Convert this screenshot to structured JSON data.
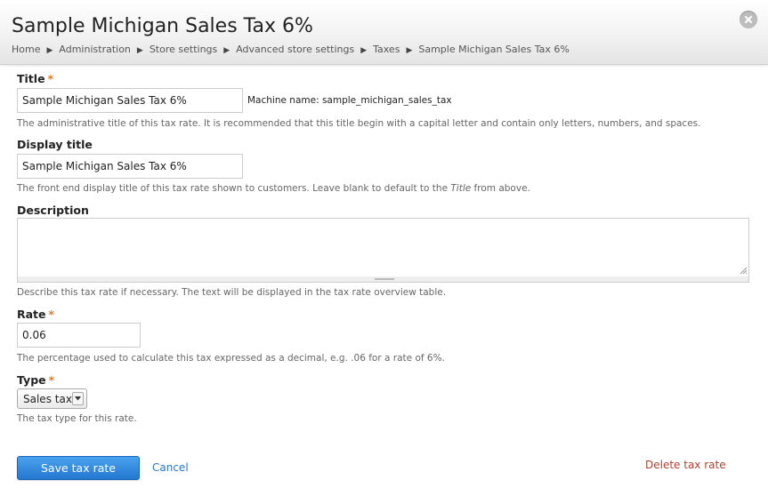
{
  "header": {
    "title": "Sample Michigan Sales Tax 6%",
    "breadcrumb": [
      "Home",
      "Administration",
      "Store settings",
      "Advanced store settings",
      "Taxes",
      "Sample Michigan Sales Tax 6%"
    ],
    "breadcrumb_separator": "▶"
  },
  "form": {
    "required_marker": "*",
    "title": {
      "label": "Title",
      "value": "Sample Michigan Sales Tax 6%",
      "machine_name": "Machine name: sample_michigan_sales_tax",
      "description": "The administrative title of this tax rate. It is recommended that this title begin with a capital letter and contain only letters, numbers, and spaces."
    },
    "display_title": {
      "label": "Display title",
      "value": "Sample Michigan Sales Tax 6%",
      "description_before": "The front end display title of this tax rate shown to customers. Leave blank to default to the ",
      "description_emphasis": "Title",
      "description_after": " from above."
    },
    "description": {
      "label": "Description",
      "value": "",
      "description": "Describe this tax rate if necessary. The text will be displayed in the tax rate overview table."
    },
    "rate": {
      "label": "Rate",
      "value": "0.06",
      "description": "The percentage used to calculate this tax expressed as a decimal, e.g. .06 for a rate of 6%."
    },
    "type": {
      "label": "Type",
      "selected": "Sales tax",
      "description": "The tax type for this rate."
    }
  },
  "actions": {
    "save_label": "Save tax rate",
    "cancel_label": "Cancel",
    "delete_label": "Delete tax rate"
  },
  "colors": {
    "required": "#e07b20",
    "primary_button": "#2f86dd",
    "link": "#2a77c9",
    "delete_link": "#b0412e"
  },
  "icons": {
    "close": "close-icon",
    "breadcrumb_separator": "triangle-right-icon",
    "select_arrow": "chevron-down-icon",
    "resize": "resize-corner-icon"
  }
}
